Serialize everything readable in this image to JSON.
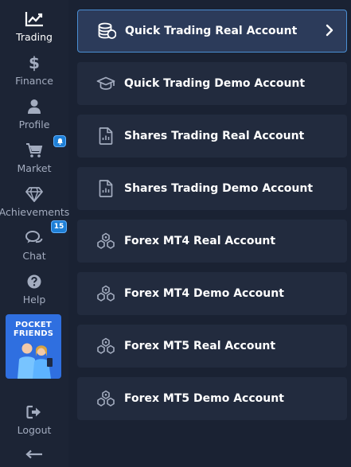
{
  "sidebar": {
    "items": [
      {
        "label": "Trading",
        "icon": "chart-trend-icon",
        "active": true
      },
      {
        "label": "Finance",
        "icon": "dollar-icon"
      },
      {
        "label": "Profile",
        "icon": "user-icon"
      },
      {
        "label": "Market",
        "icon": "cart-icon",
        "badge": "bell"
      },
      {
        "label": "Achievements",
        "icon": "diamond-icon"
      },
      {
        "label": "Chat",
        "icon": "chat-icon",
        "badge": "15"
      },
      {
        "label": "Help",
        "icon": "question-icon"
      }
    ],
    "promo": {
      "line1": "POCKET",
      "line2": "FRIENDS"
    },
    "logout_label": "Logout",
    "collapse_icon": "arrow-left-icon",
    "chat_badge": "15"
  },
  "accounts": [
    {
      "label": "Quick Trading Real Account",
      "icon": "coins-icon",
      "selected": true
    },
    {
      "label": "Quick Trading Demo Account",
      "icon": "graduation-cap-icon"
    },
    {
      "label": "Shares Trading Real Account",
      "icon": "document-chart-icon"
    },
    {
      "label": "Shares Trading Demo Account",
      "icon": "document-chart-icon"
    },
    {
      "label": "Forex MT4 Real Account",
      "icon": "network-icon"
    },
    {
      "label": "Forex MT4 Demo Account",
      "icon": "network-icon"
    },
    {
      "label": "Forex MT5 Real Account",
      "icon": "network-icon"
    },
    {
      "label": "Forex MT5 Demo Account",
      "icon": "network-icon"
    }
  ],
  "colors": {
    "background": "#1a2233",
    "sidebar": "#1c2435",
    "card": "#222b3e",
    "card_selected": "#2c3b5a",
    "accent_border": "#4a8fd4",
    "badge": "#1e7fd6",
    "promo": "#2f6fe0"
  }
}
